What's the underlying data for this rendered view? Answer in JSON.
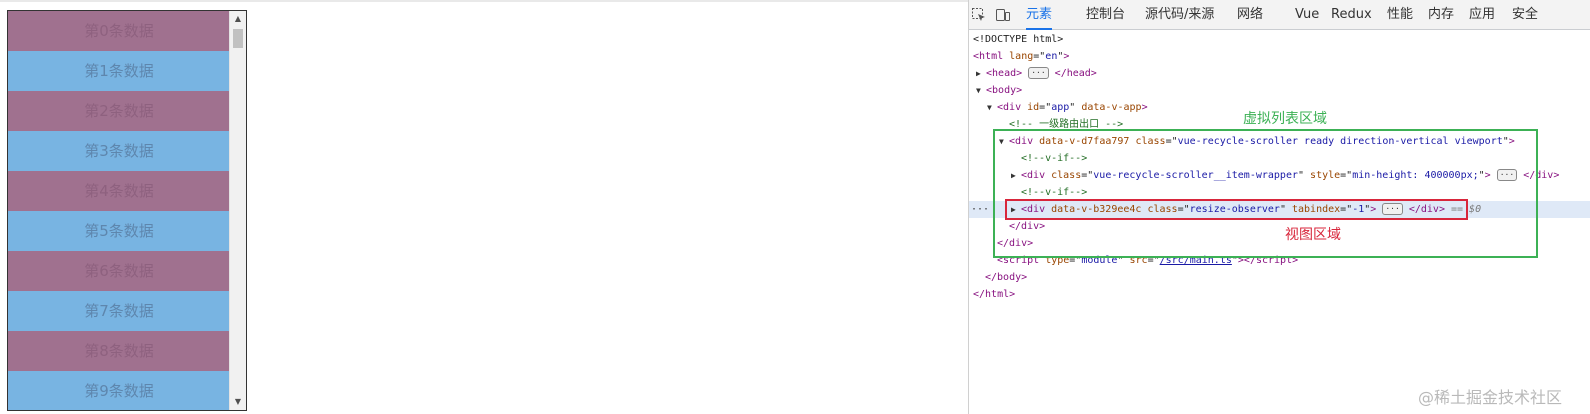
{
  "list": {
    "rows": [
      "第0条数据",
      "第1条数据",
      "第2条数据",
      "第3条数据",
      "第4条数据",
      "第5条数据",
      "第6条数据",
      "第7条数据",
      "第8条数据",
      "第9条数据"
    ],
    "colors": {
      "odd": "#a0718f",
      "even": "#78b4e2"
    }
  },
  "devtools": {
    "tabs": [
      "元素",
      "控制台",
      "源代码/来源",
      "网络",
      "Vue",
      "Redux",
      "性能",
      "内存",
      "应用",
      "安全"
    ],
    "active_tab": "元素",
    "accent": "#1a73e8",
    "tree": {
      "doctype": "<!DOCTYPE html>",
      "html_tag": "html",
      "html_lang": "en",
      "head_tag": "head",
      "body_tag": "body",
      "app_div": {
        "tag": "div",
        "id": "app",
        "attr": "data-v-app"
      },
      "comment_router": "<!-- 一级路由出口 -->",
      "scroller": {
        "tag": "div",
        "attr": "data-v-d7faa797",
        "class": "vue-recycle-scroller ready direction-vertical viewport"
      },
      "comment_vif1": "<!--v-if-->",
      "wrapper": {
        "tag": "div",
        "class": "vue-recycle-scroller__item-wrapper",
        "style": "min-height: 400000px;"
      },
      "comment_vif2": "<!--v-if-->",
      "resize": {
        "tag": "div",
        "attr": "data-v-b329ee4c",
        "class": "resize-observer",
        "tabindex": "-1",
        "suffix": "== $0"
      },
      "close_div": "</div>",
      "script": {
        "type": "module",
        "src": "/src/main.ts"
      },
      "close_body": "</body>",
      "close_html": "</html>"
    },
    "annotations": {
      "green_label": "虚拟列表区域",
      "red_label": "视图区域"
    }
  },
  "watermark": "@稀土掘金技术社区"
}
